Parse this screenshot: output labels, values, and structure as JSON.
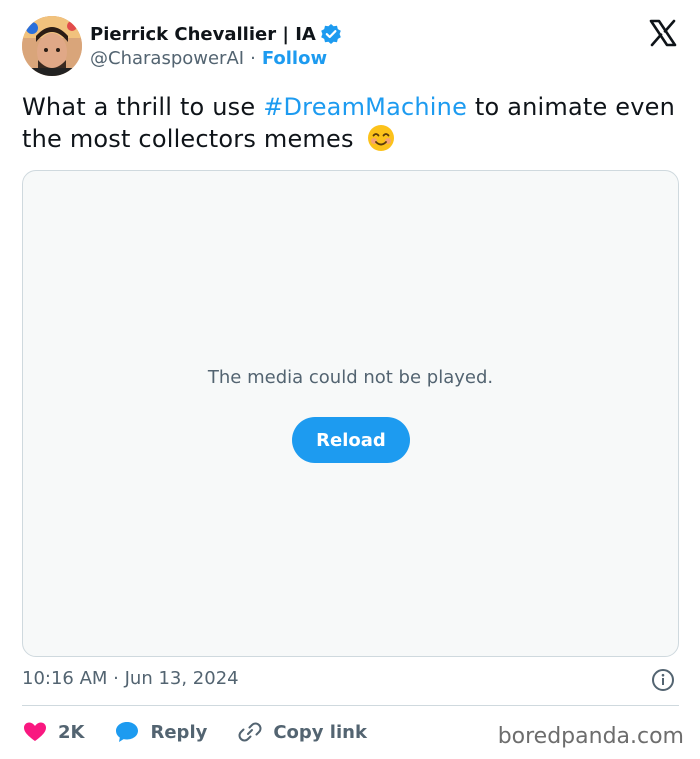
{
  "author": {
    "display_name": "Pierrick Chevallier | IA",
    "handle": "@CharaspowerAI",
    "separator": "·",
    "follow_label": "Follow"
  },
  "tweet": {
    "text_before": "What a thrill to use ",
    "hashtag": "#DreamMachine",
    "text_after": "  to animate even the most collectors memes",
    "emoji": "smiling-face-emoji"
  },
  "media": {
    "message": "The media could not be played.",
    "reload_label": "Reload"
  },
  "timestamp": "10:16 AM · Jun 13, 2024",
  "actions": {
    "like_count": "2K",
    "reply_label": "Reply",
    "copy_link_label": "Copy link"
  },
  "watermark": "boredpanda.com",
  "colors": {
    "accent": "#1d9bf0",
    "like": "#f91880",
    "text": "#0f1419",
    "muted": "#536471"
  }
}
